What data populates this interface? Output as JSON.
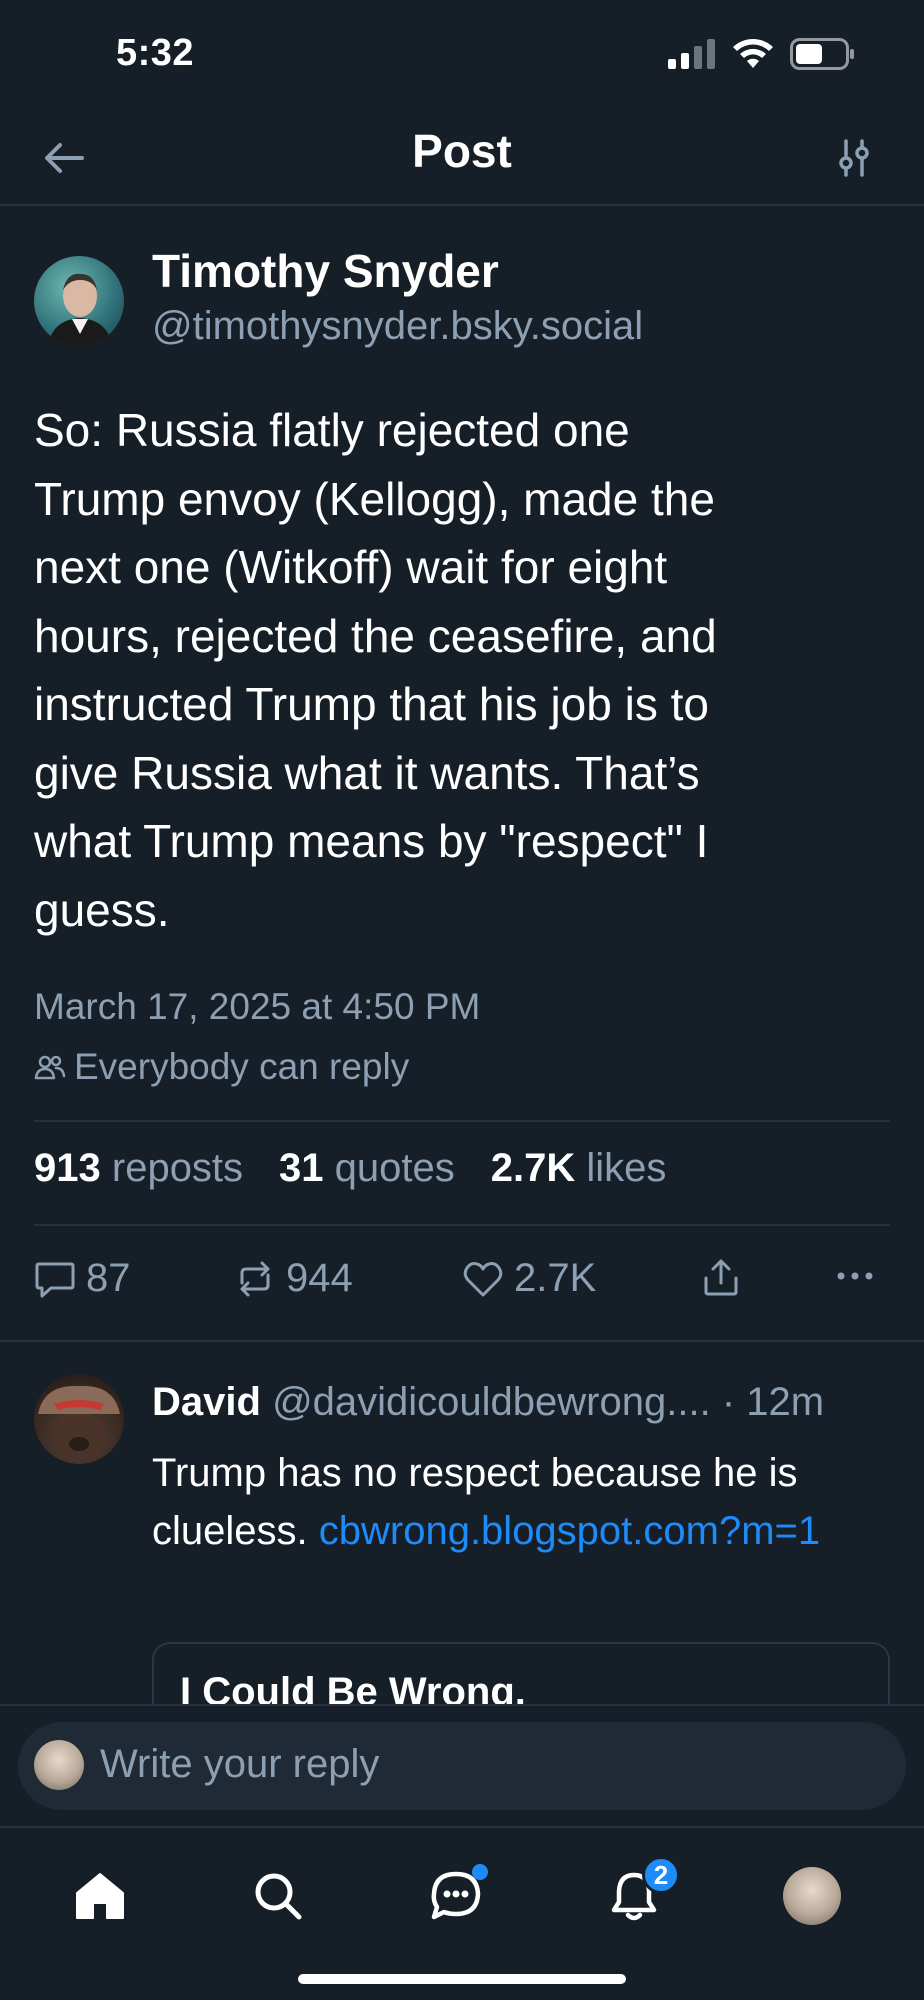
{
  "status_bar": {
    "time": "5:32"
  },
  "header": {
    "title": "Post"
  },
  "post": {
    "author_name": "Timothy Snyder",
    "author_handle": "@timothysnyder.bsky.social",
    "text": "So: Russia flatly rejected one\nTrump envoy (Kellogg), made the\nnext one (Witkoff) wait for eight\nhours, rejected the ceasefire, and\ninstructed Trump that his job is to\ngive Russia what it wants. That’s\nwhat Trump means by \"respect\" I\nguess.",
    "date": "March 17, 2025 at 4:50 PM",
    "reply_setting": "Everybody can reply",
    "stats": {
      "reposts_count": "913",
      "reposts_label": "reposts",
      "quotes_count": "31",
      "quotes_label": "quotes",
      "likes_count": "2.7K",
      "likes_label": "likes"
    },
    "actions": {
      "replies": "87",
      "reposts": "944",
      "likes": "2.7K"
    }
  },
  "reply": {
    "name": "David",
    "handle": "@davidicouldbewrong....",
    "time": "· 12m",
    "text_before_link": "Trump has no respect because he is clueless. ",
    "link": "cbwrong.blogspot.com?m=1",
    "card_title": "I Could Be Wrong."
  },
  "composer": {
    "placeholder": "Write your reply"
  },
  "tabbar": {
    "notifications_badge": "2"
  },
  "colors": {
    "background": "#161e27",
    "accent": "#1d8cf8",
    "muted_text": "#8da0b3"
  }
}
